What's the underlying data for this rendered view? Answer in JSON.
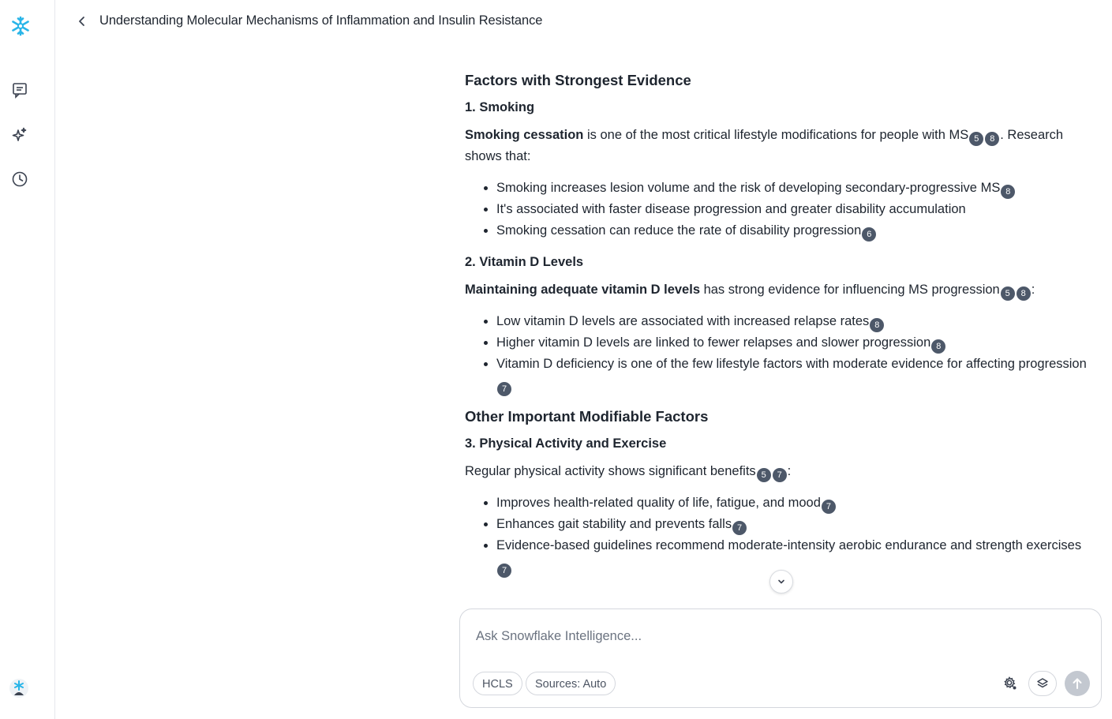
{
  "header": {
    "title": "Understanding Molecular Mechanisms of Inflammation and Insulin Resistance"
  },
  "sidebar": {
    "icons": [
      "snowflake-logo-icon",
      "chats-icon",
      "sparkle-icon",
      "history-icon",
      "user-avatar-icon"
    ]
  },
  "content": {
    "section1_heading": "Factors with Strongest Evidence",
    "smoking": {
      "heading": "1. Smoking",
      "lead_bold": "Smoking cessation",
      "lead_text": " is one of the most critical lifestyle modifications for people with MS",
      "lead_cites": [
        "5",
        "8"
      ],
      "lead_tail": ". Research shows that:",
      "bullets": [
        {
          "text": "Smoking increases lesion volume and the risk of developing secondary-progressive MS",
          "cites": [
            "8"
          ]
        },
        {
          "text": "It's associated with faster disease progression and greater disability accumulation",
          "cites": []
        },
        {
          "text": "Smoking cessation can reduce the rate of disability progression",
          "cites": [
            "6"
          ]
        }
      ]
    },
    "vitd": {
      "heading": "2. Vitamin D Levels",
      "lead_bold": "Maintaining adequate vitamin D levels",
      "lead_text": " has strong evidence for influencing MS progression",
      "lead_cites": [
        "5",
        "8"
      ],
      "lead_tail": ":",
      "bullets": [
        {
          "text": "Low vitamin D levels are associated with increased relapse rates",
          "cites": [
            "8"
          ]
        },
        {
          "text": "Higher vitamin D levels are linked to fewer relapses and slower progression",
          "cites": [
            "8"
          ]
        },
        {
          "text": "Vitamin D deficiency is one of the few lifestyle factors with moderate evidence for affecting progression",
          "cites": [
            "7"
          ]
        }
      ]
    },
    "section2_heading": "Other Important Modifiable Factors",
    "exercise": {
      "heading": "3. Physical Activity and Exercise",
      "lead_text": "Regular physical activity shows significant benefits",
      "lead_cites": [
        "5",
        "7"
      ],
      "lead_tail": ":",
      "bullets": [
        {
          "text": "Improves health-related quality of life, fatigue, and mood",
          "cites": [
            "7"
          ]
        },
        {
          "text": "Enhances gait stability and prevents falls",
          "cites": [
            "7"
          ]
        },
        {
          "text": "Evidence-based guidelines recommend moderate-intensity aerobic endurance and strength exercises",
          "cites": [
            "7"
          ]
        }
      ]
    }
  },
  "composer": {
    "placeholder": "Ask Snowflake Intelligence...",
    "chips": [
      "HCLS",
      "Sources: Auto"
    ]
  },
  "colors": {
    "citation_badge": "#4d5869",
    "logo": "#29b5e8",
    "send_disabled": "#c3c8d0"
  }
}
